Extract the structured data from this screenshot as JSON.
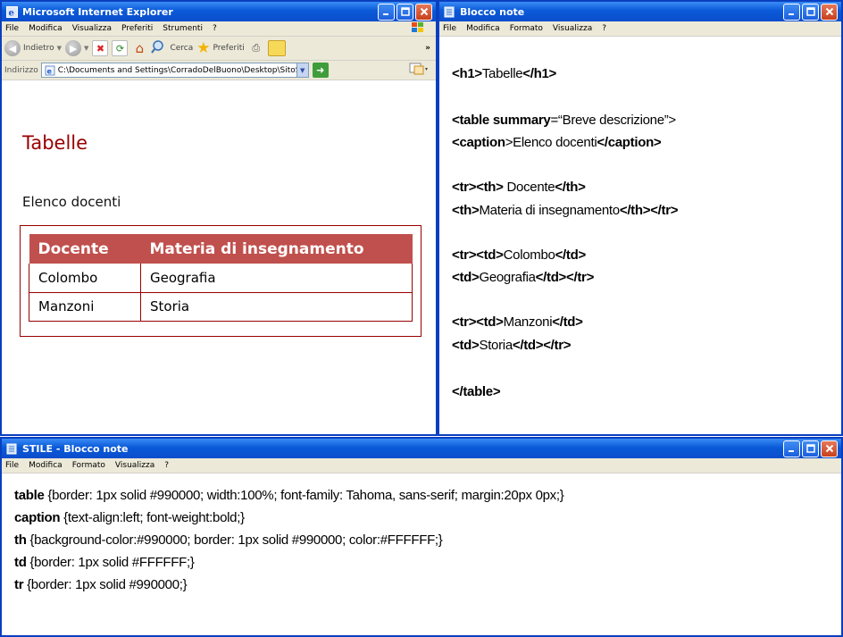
{
  "ie": {
    "title": "Microsoft Internet Explorer",
    "menu": [
      "File",
      "Modifica",
      "Visualizza",
      "Preferiti",
      "Strumenti",
      "?"
    ],
    "toolbar": {
      "back_label": "Indietro",
      "search_label": "Cerca",
      "favorites_label": "Preferiti"
    },
    "address": {
      "label": "Indirizzo",
      "value": "C:\\Documents and Settings\\CorradoDelBuono\\Desktop\\SitoScolast"
    },
    "page": {
      "heading": "Tabelle",
      "caption": "Elenco docenti",
      "headers": [
        "Docente",
        "Materia di insegnamento"
      ],
      "rows": [
        [
          "Colombo",
          "Geografia"
        ],
        [
          "Manzoni",
          "Storia"
        ]
      ]
    },
    "colors": {
      "heading": "#990000",
      "th_bg": "#c0504d",
      "border": "#990000"
    }
  },
  "notepad": {
    "title": "Blocco note",
    "menu": [
      "File",
      "Modifica",
      "Formato",
      "Visualizza",
      "?"
    ],
    "lines": [
      {
        "b1": "<h1>",
        "t1": "Tabelle",
        "b2": "</h1>"
      },
      {
        "b1": "<table summary",
        "t1": "=“Breve descrizione”>"
      },
      {
        "b1": "<caption",
        "t1": ">Elenco docenti",
        "b2": "</caption>"
      },
      {
        "b1": "<tr><th>",
        "t1": " Docente",
        "b2": "</th>"
      },
      {
        "b1": "<th>",
        "t1": "Materia di insegnamento",
        "b2": "</th></tr>"
      },
      {
        "b1": "<tr><td>",
        "t1": "Colombo",
        "b2": "</td>"
      },
      {
        "b1": "<td>",
        "t1": "Geografia",
        "b2": "</td></tr>"
      },
      {
        "b1": "<tr><td>",
        "t1": "Manzoni",
        "b2": "</td>"
      },
      {
        "b1": "<td>",
        "t1": "Storia",
        "b2": "</td></tr>"
      },
      {
        "b1": "</table>"
      }
    ]
  },
  "stile": {
    "title": "STILE - Blocco note",
    "menu": [
      "File",
      "Modifica",
      "Formato",
      "Visualizza",
      "?"
    ],
    "rules": [
      {
        "sel": "table",
        "decl": " {border: 1px solid #990000;  width:100%; font-family: Tahoma, sans-serif; margin:20px 0px;}"
      },
      {
        "sel": "caption",
        "decl": " {text-align:left; font-weight:bold;}"
      },
      {
        "sel": "th",
        "decl": " {background-color:#990000;  border: 1px solid #990000; color:#FFFFFF;}"
      },
      {
        "sel": "td",
        "decl": " {border: 1px solid #FFFFFF;}"
      },
      {
        "sel": "tr",
        "decl": " {border: 1px solid #990000;}"
      }
    ]
  }
}
